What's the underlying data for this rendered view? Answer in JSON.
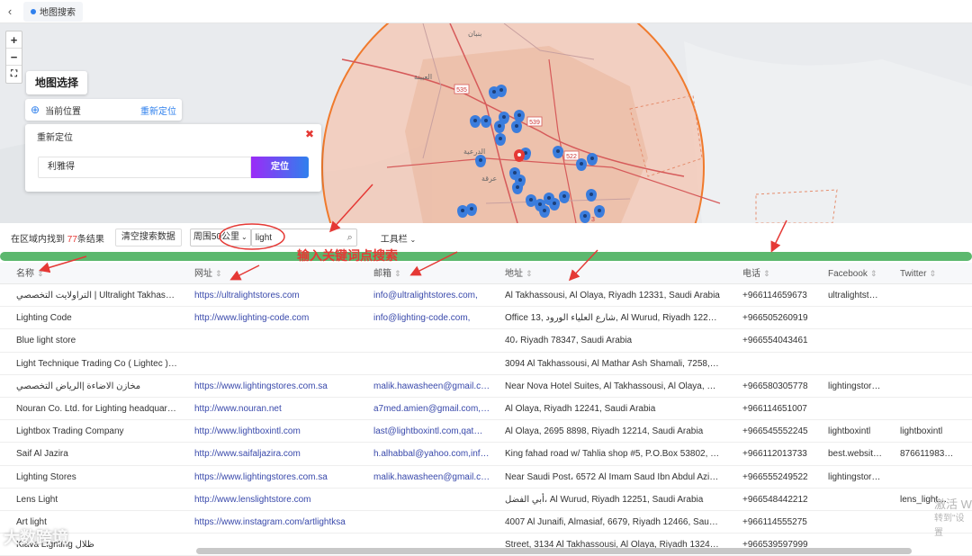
{
  "topbar": {
    "back_icon": "chevron-left-icon",
    "tab_label": "地图搜索"
  },
  "map": {
    "zoom_in": "+",
    "zoom_out": "−",
    "fullscreen_icon": "expand-icon",
    "map_select": "地图选择",
    "current_position": "当前位置",
    "relocate_link": "重新定位",
    "relocate_panel": {
      "title": "重新定位",
      "place_value": "利雅得",
      "locate_button": "定位"
    },
    "road_labels": [
      "535",
      "539",
      "522",
      "3"
    ],
    "place_labels": [
      "العيينة",
      "الدرعية",
      "عرقة",
      "بنبان"
    ],
    "circle_color": "#f07a2c",
    "marker_color": "#3b7ddd",
    "center_marker_color": "#e53935"
  },
  "toolbar": {
    "found_prefix": "在区域内找到 ",
    "found_count": "77",
    "found_suffix": "条结果",
    "clear_button": "清空搜索数据",
    "radius_select": "周围50公里",
    "search_value": "light",
    "tools_label": "工具栏",
    "hint": "输入关键词点搜索"
  },
  "table": {
    "headers": [
      "名称",
      "网址",
      "邮箱",
      "地址",
      "电话",
      "Facebook",
      "Twitter"
    ],
    "rows": [
      [
        "التراولايت التخصصي | Ultralight Takhassusi",
        "https://ultralightstores.com",
        "info@ultralightstores.com,",
        "Al Takhassousi, Al Olaya, Riyadh 12331, Saudi Arabia",
        "+966114659673",
        "ultralightst…",
        ""
      ],
      [
        "Lighting Code",
        "http://www.lighting-code.com",
        "info@lighting-code.com,",
        "Office 13, شارع العلياء الورود, Al Wurud, Riyadh 12215 …",
        "+966505260919",
        "",
        ""
      ],
      [
        "Blue light store",
        "",
        "",
        "40، Riyadh 78347, Saudi Arabia",
        "+966554043461",
        "",
        ""
      ],
      [
        "Light Technique Trading Co ( Lightec ) …",
        "",
        "",
        "3094 Al Takhassousi, Al Mathar Ash Shamali, 7258, Ri…",
        "",
        "",
        ""
      ],
      [
        "مخازن الاضاءة |الرياض التخصصي",
        "https://www.lightingstores.com.sa",
        "malik.hawasheen@gmail.c…",
        "Near Nova Hotel Suites, Al Takhassousi, Al Olaya, Riy…",
        "+966580305778",
        "lightingstor…",
        ""
      ],
      [
        "Nouran Co. Ltd. for Lighting headquar…",
        "http://www.nouran.net",
        "a7med.amien@gmail.com,…",
        "Al Olaya, Riyadh 12241, Saudi Arabia",
        "+966114651007",
        "",
        ""
      ],
      [
        "Lightbox Trading Company",
        "http://www.lightboxintl.com",
        "last@lightboxintl.com,qat…",
        "Al Olaya, 2695 8898, Riyadh 12214, Saudi Arabia",
        "+966545552245",
        "lightboxintl",
        "lightboxintl"
      ],
      [
        "Saif Al Jazira",
        "http://www.saifaljazira.com",
        "h.alhabbal@yahoo.com,inf…",
        "King fahad road w/ Tahlia shop #5, P.O.Box 53802, Ri…",
        "+966112013733",
        "best.websit…",
        "876611983…"
      ],
      [
        "Lighting Stores",
        "https://www.lightingstores.com.sa",
        "malik.hawasheen@gmail.c…",
        "Near Saudi Post، 6572 Al Imam Saud Ibn Abdul Aziz …",
        "+966555249522",
        "lightingstor…",
        ""
      ],
      [
        "Lens Light",
        "http://www.lenslightstore.com",
        "",
        "أبي الفضل، Al Wurud, Riyadh 12251, Saudi Arabia",
        "+966548442212",
        "",
        "lens_light…"
      ],
      [
        "Art light",
        "https://www.instagram.com/artlightksa",
        "",
        "4007 Al Junaifi, Almasiaf, 6679, Riyadh 12466, Saudi …",
        "+966114555275",
        "",
        ""
      ],
      [
        "Kiava Lighting ظلال",
        "",
        "",
        "Street, 3134 Al Takhassousi, Al Olaya, Riyadh 13245, S…",
        "+966539597999",
        "",
        ""
      ]
    ]
  },
  "overlay": {
    "watermark": "大数跨境",
    "activate_title": "激活 W",
    "activate_sub": "转到\"设置"
  }
}
